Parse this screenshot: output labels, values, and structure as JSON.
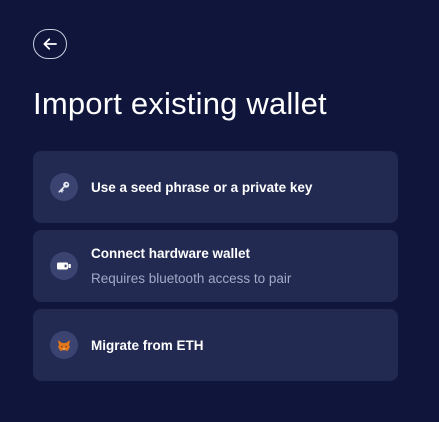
{
  "header": {
    "back_icon": "arrow-left-icon",
    "title": "Import existing wallet"
  },
  "options": [
    {
      "icon": "key-icon",
      "label": "Use a seed phrase or a private key"
    },
    {
      "icon": "hardware-wallet-icon",
      "label": "Connect hardware wallet",
      "sublabel": "Requires bluetooth access to pair"
    },
    {
      "icon": "fox-icon",
      "label": "Migrate from ETH"
    }
  ],
  "colors": {
    "background": "#0f153b",
    "card": "#222a52",
    "icon_circle": "#3b4470",
    "secondary_text": "#a3a9c7",
    "fox_orange": "#e2761b"
  }
}
